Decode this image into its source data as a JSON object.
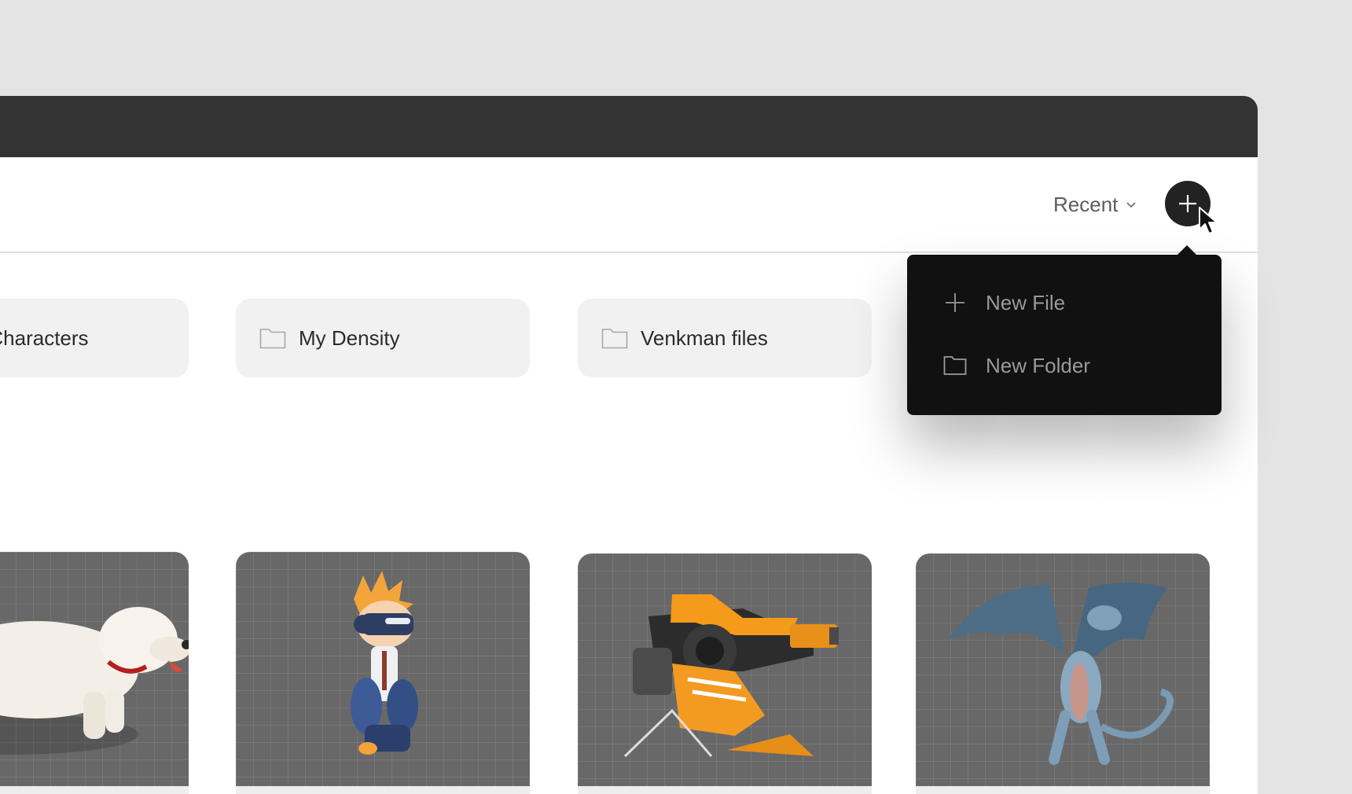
{
  "toolbar": {
    "sort_label": "Recent",
    "sort_icon": "chevron-down-icon",
    "add_icon": "plus-icon"
  },
  "folders": [
    {
      "label": "Sample Characters",
      "icon": "folder-icon"
    },
    {
      "label": "My Density",
      "icon": "folder-icon"
    },
    {
      "label": "Venkman files",
      "icon": "folder-icon"
    }
  ],
  "files": [
    {
      "preview": "white dog character"
    },
    {
      "preview": "spiky-haired kid with VR goggles"
    },
    {
      "preview": "orange mech turret"
    },
    {
      "preview": "blue winged dragon"
    }
  ],
  "new_menu": {
    "items": [
      {
        "label": "New File",
        "icon": "plus-icon"
      },
      {
        "label": "New Folder",
        "icon": "folder-icon"
      }
    ]
  },
  "colors": {
    "titlebar": "#333333",
    "menu_bg": "#111111",
    "card_bg": "#f1f1f1",
    "thumb_bg": "#686868"
  }
}
